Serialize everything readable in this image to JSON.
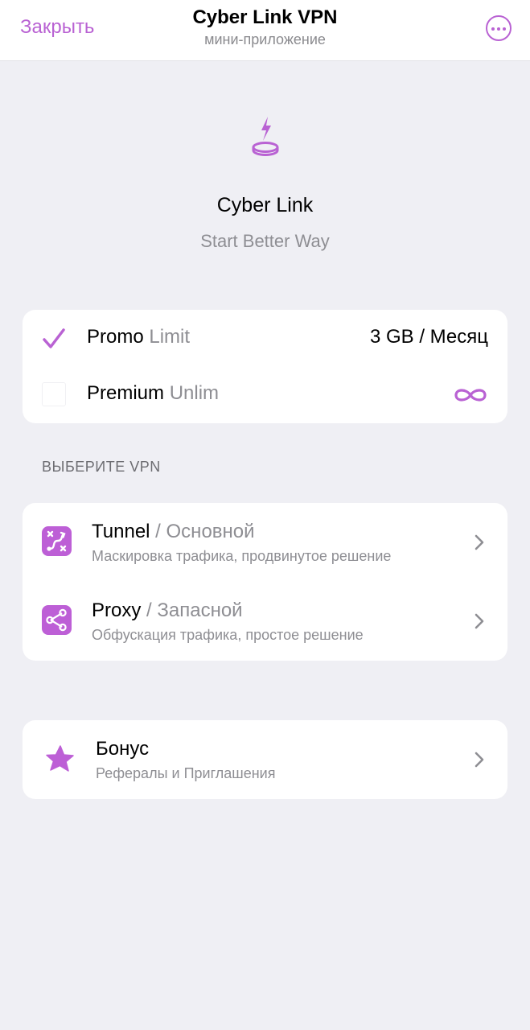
{
  "header": {
    "close_label": "Закрыть",
    "title": "Cyber Link VPN",
    "subtitle": "мини-приложение"
  },
  "hero": {
    "title": "Cyber Link",
    "subtitle": "Start Better Way"
  },
  "plans": [
    {
      "name": "Promo",
      "tag": "Limit",
      "value": "3 GB / Месяц",
      "selected": true
    },
    {
      "name": "Premium",
      "tag": "Unlim",
      "value_icon": "infinity-icon",
      "selected": false
    }
  ],
  "vpn_section": {
    "header": "ВЫБЕРИТЕ VPN",
    "items": [
      {
        "name": "Tunnel",
        "sep": " / ",
        "tag": "Основной",
        "desc": "Маскировка трафика, продвинутое решение",
        "icon": "route-icon"
      },
      {
        "name": "Proxy",
        "sep": " / ",
        "tag": "Запасной",
        "desc": "Обфускация трафика, простое решение",
        "icon": "share-icon"
      }
    ]
  },
  "bonus": {
    "title": "Бонус",
    "desc": "Рефералы и Приглашения",
    "icon": "star-icon"
  },
  "colors": {
    "accent": "#b962d3",
    "background": "#efeff4",
    "muted_text": "#8e8e93"
  }
}
